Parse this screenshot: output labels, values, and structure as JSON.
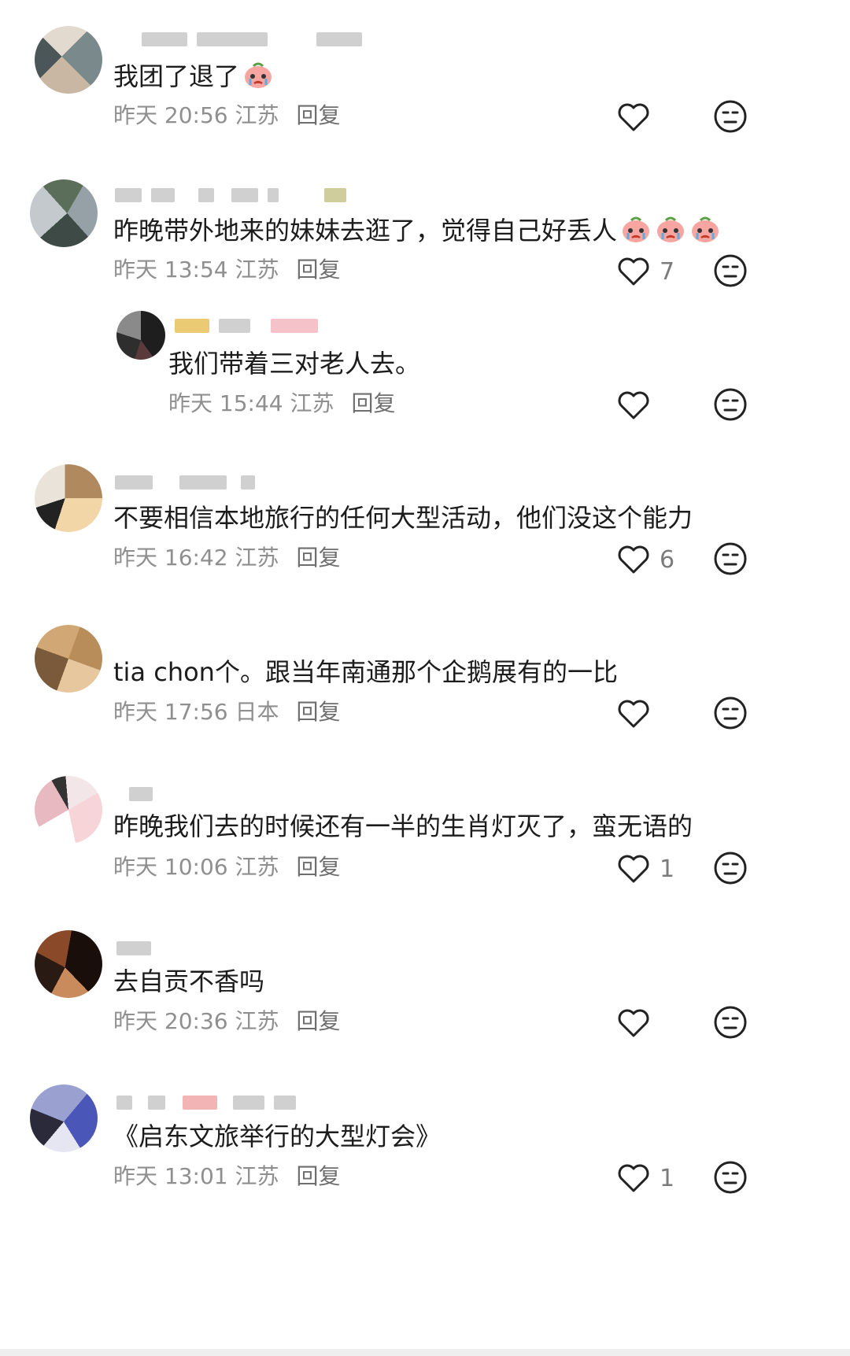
{
  "comments": [
    {
      "text": "我团了退了",
      "emoji_count": 1,
      "time": "昨天 20:56",
      "location": "江苏",
      "reply_label": "回复",
      "likes": ""
    },
    {
      "text": "昨晚带外地来的妹妹去逛了，觉得自己好丢人",
      "emoji_count": 3,
      "time": "昨天 13:54",
      "location": "江苏",
      "reply_label": "回复",
      "likes": "7"
    },
    {
      "text": "我们带着三对老人去。",
      "emoji_count": 0,
      "time": "昨天 15:44",
      "location": "江苏",
      "reply_label": "回复",
      "likes": "",
      "is_reply": true
    },
    {
      "text": "不要相信本地旅行的任何大型活动，他们没这个能力",
      "emoji_count": 0,
      "time": "昨天 16:42",
      "location": "江苏",
      "reply_label": "回复",
      "likes": "6"
    },
    {
      "text": "tia chon个。跟当年南通那个企鹅展有的一比",
      "emoji_count": 0,
      "time": "昨天 17:56",
      "location": "日本",
      "reply_label": "回复",
      "likes": ""
    },
    {
      "text": "昨晚我们去的时候还有一半的生肖灯灭了，蛮无语的",
      "emoji_count": 0,
      "time": "昨天 10:06",
      "location": "江苏",
      "reply_label": "回复",
      "likes": "1"
    },
    {
      "text": "去自贡不香吗",
      "emoji_count": 0,
      "time": "昨天 20:36",
      "location": "江苏",
      "reply_label": "回复",
      "likes": ""
    },
    {
      "text": "《启东文旅举行的大型灯会》",
      "emoji_count": 0,
      "time": "昨天 13:01",
      "location": "江苏",
      "reply_label": "回复",
      "likes": "1"
    }
  ],
  "icons": {
    "like": "heart-outline-icon",
    "dislike": "neutral-face-icon",
    "emoji": "crying-peach-emoji"
  }
}
